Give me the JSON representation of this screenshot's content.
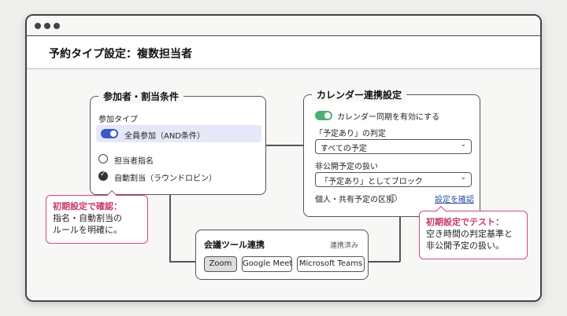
{
  "window": {
    "title": "予約タイプ設定：複数担当者"
  },
  "participants_panel": {
    "legend": "参加者・割当条件",
    "type_label": "参加タイプ",
    "toggle_option": "全員参加（AND条件）",
    "radio_options": [
      "担当者指名",
      "自動割当（ラウンドロビン）"
    ],
    "selected_radio": "自動割当（ラウンドロビン）"
  },
  "calendar_panel": {
    "legend": "カレンダー連携設定",
    "sync_toggle_label": "カレンダー同期を有効にする",
    "busy_judgement_label": "「予定あり」の判定",
    "busy_judgement_value": "すべての予定",
    "private_handling_label": "非公開予定の扱い",
    "private_handling_value": "「予定あり」としてブロック",
    "distinction_label": "個人・共有予定の区別",
    "check_link": "設定を確認"
  },
  "meeting_panel": {
    "title": "会議ツール連携",
    "status": "連携済み",
    "tools": [
      "Zoom",
      "Google Meet",
      "Microsoft Teams"
    ],
    "selected_tool": "Zoom"
  },
  "callouts": {
    "left": {
      "heading": "初期設定で確認：",
      "line1": "指名・自動割当の",
      "line2": "ルールを明確に。"
    },
    "right": {
      "heading": "初期設定でテスト：",
      "line1": "空き時間の判定基準と",
      "line2": "非公開予定の扱い。"
    }
  },
  "colors": {
    "toggle_blue": "#3a5bc7",
    "toggle_green": "#4caf73",
    "selected_option_bg": "#e4e8f7",
    "callout_accent": "#c8366a",
    "link": "#2a4fa0"
  }
}
